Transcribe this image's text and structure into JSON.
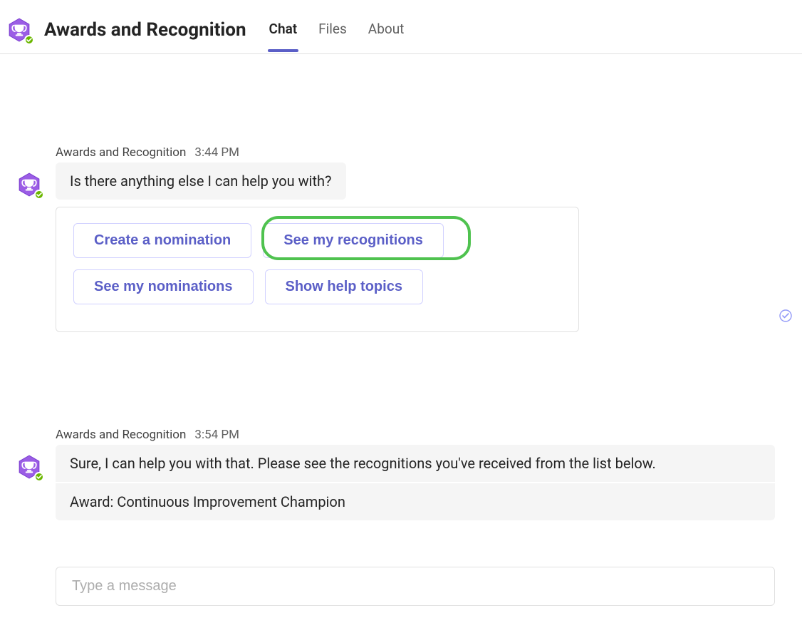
{
  "header": {
    "title": "Awards and Recognition",
    "tabs": [
      {
        "label": "Chat",
        "active": true
      },
      {
        "label": "Files",
        "active": false
      },
      {
        "label": "About",
        "active": false
      }
    ]
  },
  "messages": [
    {
      "sender": "Awards and Recognition",
      "time": "3:44 PM",
      "text": "Is there anything else I can help you with?",
      "actions_row1": [
        {
          "label": "Create a nomination"
        },
        {
          "label": "See my recognitions",
          "highlighted": true
        }
      ],
      "actions_row2": [
        {
          "label": "See my nominations"
        },
        {
          "label": "Show help topics"
        }
      ]
    },
    {
      "sender": "Awards and Recognition",
      "time": "3:54 PM",
      "text_line1": "Sure, I can help you with that. Please see the recognitions you've received from the list below.",
      "text_line2": "Award: Continuous Improvement Champion"
    }
  ],
  "composer": {
    "placeholder": "Type a message"
  },
  "colors": {
    "accent": "#5b5fc7",
    "highlight": "#4fc24f",
    "presence": "#6bb700"
  }
}
